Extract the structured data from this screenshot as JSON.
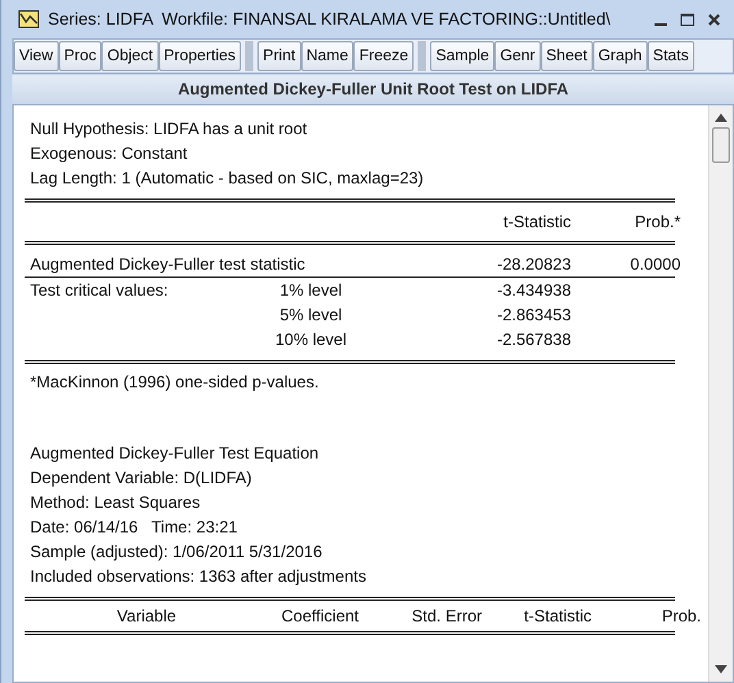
{
  "window": {
    "series": "Series: LIDFA",
    "workfile": "Workfile: FINANSAL KIRALAMA VE FACTORING::Untitled\\"
  },
  "toolbar": [
    [
      "View",
      "Proc",
      "Object",
      "Properties"
    ],
    [
      "Print",
      "Name",
      "Freeze"
    ],
    [
      "Sample",
      "Genr",
      "Sheet",
      "Graph",
      "Stats"
    ]
  ],
  "heading": "Augmented Dickey-Fuller Unit Root Test on LIDFA",
  "header_lines": [
    "Null Hypothesis: LIDFA has a unit root",
    "Exogenous: Constant",
    "Lag Length: 1 (Automatic - based on SIC, maxlag=23)"
  ],
  "test_table": {
    "columns": [
      "t-Statistic",
      "Prob.*"
    ],
    "rows": [
      {
        "label": "Augmented Dickey-Fuller test statistic",
        "t_statistic": "-28.20823",
        "prob": "0.0000"
      },
      {
        "label": "Test critical values:",
        "level": "1% level",
        "t_statistic": "-3.434938"
      },
      {
        "level": "5% level",
        "t_statistic": "-2.863453"
      },
      {
        "level": "10% level",
        "t_statistic": "-2.567838"
      }
    ]
  },
  "footnote": "*MacKinnon (1996) one-sided p-values.",
  "equation_lines": [
    "Augmented Dickey-Fuller Test Equation",
    "Dependent Variable: D(LIDFA)",
    "Method: Least Squares",
    "Date: 06/14/16   Time: 23:21",
    "Sample (adjusted): 1/06/2011 5/31/2016",
    "Included observations: 1363 after adjustments"
  ],
  "coef_table": {
    "columns": [
      "Variable",
      "Coefficient",
      "Std. Error",
      "t-Statistic",
      "Prob."
    ]
  }
}
